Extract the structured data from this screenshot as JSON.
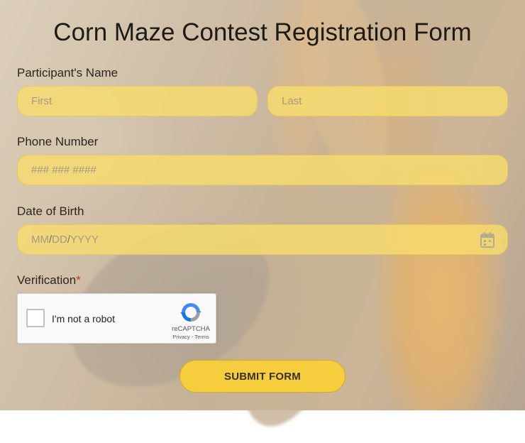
{
  "form": {
    "title": "Corn Maze Contest Registration Form",
    "name_label": "Participant's Name",
    "first_placeholder": "First",
    "last_placeholder": "Last",
    "phone_label": "Phone Number",
    "phone_placeholder": "### ### ####",
    "dob_label": "Date of Birth",
    "dob_month": "MM",
    "dob_day": "DD",
    "dob_year": "YYYY",
    "dob_sep": "/",
    "verification_label": "Verification",
    "required_mark": "*",
    "captcha_text": "I'm not a robot",
    "captcha_brand": "reCAPTCHA",
    "captcha_links": "Privacy - Terms",
    "submit_label": "SUBMIT FORM",
    "calendar_icon": "calendar-icon",
    "accent_color": "#f6cd3c",
    "field_color": "#f8dc6e"
  }
}
